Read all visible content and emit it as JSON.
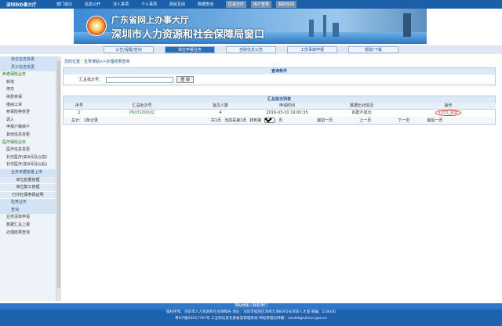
{
  "topnav": {
    "brand": "深圳市办事大厅",
    "items": [
      "部门指引",
      "信息公开",
      "法人事项",
      "个人事项",
      "政民互动",
      "数据查询"
    ],
    "gray_items": [
      "区县分厅",
      "用户登录",
      "我的空间"
    ]
  },
  "banner": {
    "line1": "广东省网上办事大厅",
    "line2": "深圳市人力资源和社会保障局窗口"
  },
  "tabs": [
    "公告/提醒/查询",
    "单位申报业务",
    "自助信息公告",
    "工伤事故申报",
    "帮助/下载"
  ],
  "sidebar": [
    {
      "label": "单位信息变更",
      "type": "head"
    },
    {
      "label": "员工信息变更",
      "type": "head"
    },
    {
      "label": "养老保险业务",
      "type": "green"
    },
    {
      "label": "新增",
      "type": "sub"
    },
    {
      "label": "停交",
      "type": "sub"
    },
    {
      "label": "续费参保",
      "type": "sub"
    },
    {
      "label": "缴纳工资",
      "type": "sub"
    },
    {
      "label": "参保险种变更",
      "type": "sub"
    },
    {
      "label": "调入",
      "type": "sub"
    },
    {
      "label": "申报户籍转户",
      "type": "sub"
    },
    {
      "label": "其他信息变更",
      "type": "sub"
    },
    {
      "label": "医疗保险业务",
      "type": "green"
    },
    {
      "label": "医疗信息变更",
      "type": "sub"
    },
    {
      "label": "补交医疗(如4月及以前)",
      "type": "sub"
    },
    {
      "label": "补交医疗(如4月及以后)",
      "type": "sub"
    },
    {
      "label": "业务单据批量上传",
      "type": "head"
    },
    {
      "label": "单位批量管理",
      "type": "btn"
    },
    {
      "label": "单位职工管理",
      "type": "btn"
    },
    {
      "label": "打印社保参保证明",
      "type": "btn"
    },
    {
      "label": "险类业务",
      "type": "head"
    },
    {
      "label": "查询",
      "type": "head"
    },
    {
      "label": "业务清单申请",
      "type": "sub"
    },
    {
      "label": "数据汇总上报",
      "type": "sub"
    },
    {
      "label": "办理结果查询",
      "type": "sub"
    }
  ],
  "breadcrumb": "您的位置：生育津贴>>办理结果查询",
  "search": {
    "title": "查询条件",
    "label": "汇总批次号：",
    "value": "",
    "button": "查 询"
  },
  "table": {
    "title": "汇总批次列表",
    "columns": [
      "序号",
      "汇总批次号",
      "批次人数",
      "申请时间",
      "数据比对情况",
      "操作"
    ],
    "rows": [
      [
        "1",
        "P603100002",
        "4",
        "2016-03-10 19:00:35",
        "匹配不成功",
        "打印汇总表"
      ]
    ],
    "pager": {
      "total": "总计:",
      "records": "1条记录",
      "pages": "共1页",
      "current": "当前是第1页",
      "goto": "转到第",
      "page_value": "1",
      "page_unit": "页",
      "first": "最前一页",
      "prev": "上一页",
      "next": "下一页",
      "last": "最后一页"
    }
  },
  "footer": {
    "line1": "网站地图 | 联系我们",
    "line2": "版权所有：深圳市人力资源和社会保障局 地址：深圳市福田区深南大道8005号深圳人才园 邮编：518040",
    "line3": "粤ICP备05017767号  工业和信息化部备案管理系统  网站管理员邮箱：xxcwd@szhrss.gov.cn"
  }
}
